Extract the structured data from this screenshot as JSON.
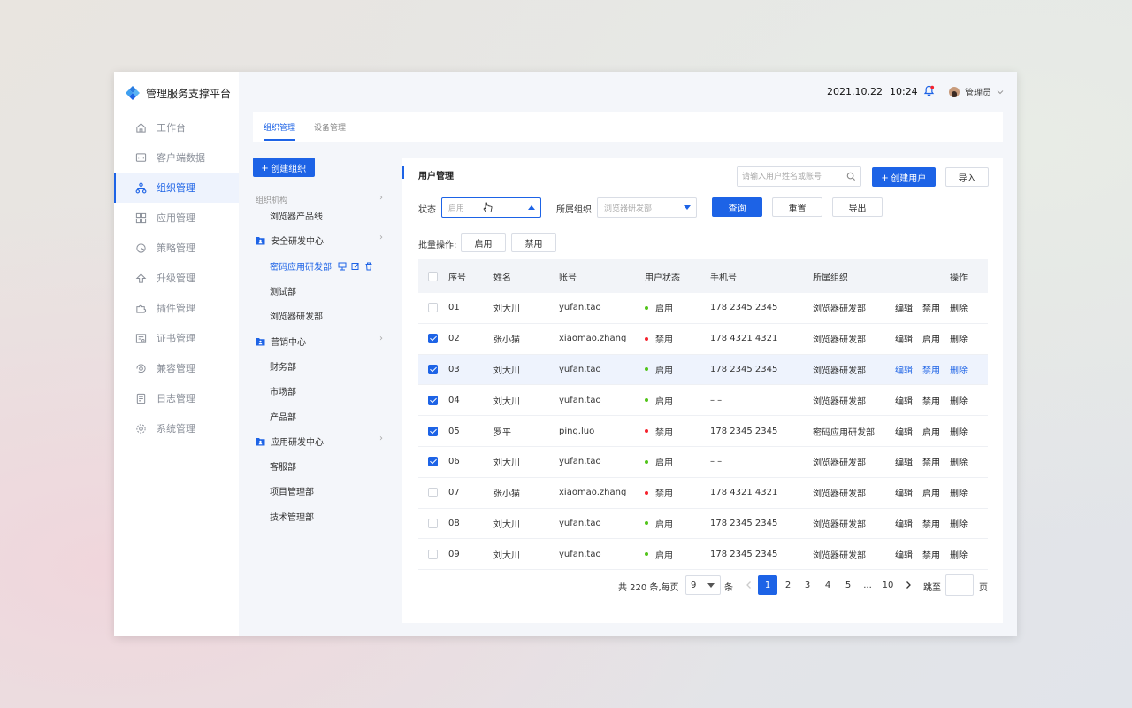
{
  "app": {
    "title": "管理服务支撑平台"
  },
  "sidebar": {
    "items": [
      {
        "label": "工作台",
        "icon": "home-icon"
      },
      {
        "label": "客户端数据",
        "icon": "client-data-icon"
      },
      {
        "label": "组织管理",
        "icon": "org-tree-icon",
        "active": true
      },
      {
        "label": "应用管理",
        "icon": "apps-grid-icon"
      },
      {
        "label": "策略管理",
        "icon": "strategy-icon"
      },
      {
        "label": "升级管理",
        "icon": "upgrade-arrow-icon"
      },
      {
        "label": "插件管理",
        "icon": "plugin-puzzle-icon"
      },
      {
        "label": "证书管理",
        "icon": "certificate-icon"
      },
      {
        "label": "兼容管理",
        "icon": "compat-icon"
      },
      {
        "label": "日志管理",
        "icon": "log-icon"
      },
      {
        "label": "系统管理",
        "icon": "settings-gear-icon"
      }
    ]
  },
  "header": {
    "date": "2021.10.22",
    "time": "10:24",
    "user": "管理员"
  },
  "tabs": [
    {
      "label": "组织管理",
      "active": true
    },
    {
      "label": "设备管理"
    }
  ],
  "org": {
    "create_label": "创建组织",
    "heading": "组织机构",
    "tree": [
      {
        "label": "浏览器产品线",
        "kind": "item"
      },
      {
        "label": "安全研发中心",
        "kind": "group"
      },
      {
        "label": "密码应用研发部",
        "kind": "item",
        "selected": true
      },
      {
        "label": "测试部",
        "kind": "item"
      },
      {
        "label": "浏览器研发部",
        "kind": "item"
      },
      {
        "label": "营销中心",
        "kind": "group"
      },
      {
        "label": "财务部",
        "kind": "item"
      },
      {
        "label": "市场部",
        "kind": "item"
      },
      {
        "label": "产品部",
        "kind": "item"
      },
      {
        "label": "应用研发中心",
        "kind": "group"
      },
      {
        "label": "客服部",
        "kind": "item"
      },
      {
        "label": "项目管理部",
        "kind": "item"
      },
      {
        "label": "技术管理部",
        "kind": "item"
      }
    ]
  },
  "main": {
    "title": "用户管理",
    "search_placeholder": "请输入用户姓名或账号",
    "create_user_label": "创建用户",
    "import_label": "导入",
    "filters": {
      "status_label": "状态",
      "status_value": "启用",
      "org_label": "所属组织",
      "org_value": "浏览器研发部",
      "query_label": "查询",
      "reset_label": "重置",
      "export_label": "导出"
    },
    "batch": {
      "label": "批量操作:",
      "enable": "启用",
      "disable": "禁用"
    }
  },
  "table": {
    "columns": [
      "序号",
      "姓名",
      "账号",
      "用户状态",
      "手机号",
      "所属组织",
      "操作"
    ],
    "rows": [
      {
        "no": "01",
        "name": "刘大川",
        "account": "yufan.tao",
        "status": "启用",
        "enabled": true,
        "phone": "178 2345 2345",
        "org": "浏览器研发部",
        "checked": false,
        "actions": [
          "编辑",
          "禁用",
          "删除"
        ]
      },
      {
        "no": "02",
        "name": "张小猫",
        "account": "xiaomao.zhang",
        "status": "禁用",
        "enabled": false,
        "phone": "178 4321 4321",
        "org": "浏览器研发部",
        "checked": true,
        "actions": [
          "编辑",
          "启用",
          "删除"
        ]
      },
      {
        "no": "03",
        "name": "刘大川",
        "account": "yufan.tao",
        "status": "启用",
        "enabled": true,
        "phone": "178 2345 2345",
        "org": "浏览器研发部",
        "checked": true,
        "highlight": true,
        "actions": [
          "编辑",
          "禁用",
          "删除"
        ]
      },
      {
        "no": "04",
        "name": "刘大川",
        "account": "yufan.tao",
        "status": "启用",
        "enabled": true,
        "phone": "– –",
        "org": "浏览器研发部",
        "checked": true,
        "actions": [
          "编辑",
          "禁用",
          "删除"
        ]
      },
      {
        "no": "05",
        "name": "罗平",
        "account": "ping.luo",
        "status": "禁用",
        "enabled": false,
        "phone": "178 2345 2345",
        "org": "密码应用研发部",
        "checked": true,
        "actions": [
          "编辑",
          "启用",
          "删除"
        ]
      },
      {
        "no": "06",
        "name": "刘大川",
        "account": "yufan.tao",
        "status": "启用",
        "enabled": true,
        "phone": "– –",
        "org": "浏览器研发部",
        "checked": true,
        "actions": [
          "编辑",
          "禁用",
          "删除"
        ]
      },
      {
        "no": "07",
        "name": "张小猫",
        "account": "xiaomao.zhang",
        "status": "禁用",
        "enabled": false,
        "phone": "178 4321 4321",
        "org": "浏览器研发部",
        "checked": false,
        "actions": [
          "编辑",
          "启用",
          "删除"
        ]
      },
      {
        "no": "08",
        "name": "刘大川",
        "account": "yufan.tao",
        "status": "启用",
        "enabled": true,
        "phone": "178 2345 2345",
        "org": "浏览器研发部",
        "checked": false,
        "actions": [
          "编辑",
          "禁用",
          "删除"
        ]
      },
      {
        "no": "09",
        "name": "刘大川",
        "account": "yufan.tao",
        "status": "启用",
        "enabled": true,
        "phone": "178 2345 2345",
        "org": "浏览器研发部",
        "checked": false,
        "actions": [
          "编辑",
          "禁用",
          "删除"
        ]
      }
    ]
  },
  "pagination": {
    "total_text": "共 220 条,每页",
    "page_size": "9",
    "unit": "条",
    "pages": [
      "1",
      "2",
      "3",
      "4",
      "5",
      "...",
      "10"
    ],
    "current": "1",
    "jump_label": "跳至",
    "page_suffix": "页"
  },
  "colors": {
    "accent": "#1d63e6",
    "enabled_dot": "#52c41a",
    "disabled_dot": "#f5222d"
  }
}
